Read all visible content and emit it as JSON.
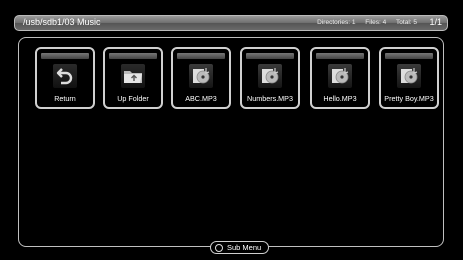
{
  "header": {
    "path": "/usb/sdb1/03 Music",
    "directories": "Directories: 1",
    "files": "Files: 4",
    "total": "Total: 5",
    "page": "1/1"
  },
  "items": [
    {
      "label": "Return",
      "icon": "return-arrow-icon"
    },
    {
      "label": "Up Folder",
      "icon": "folder-icon"
    },
    {
      "label": "ABC.MP3",
      "icon": "audio-file-icon"
    },
    {
      "label": "Numbers.MP3",
      "icon": "audio-file-icon"
    },
    {
      "label": "Hello.MP3",
      "icon": "audio-file-icon"
    },
    {
      "label": "Pretty Boy.MP3",
      "icon": "audio-file-icon"
    }
  ],
  "footer": {
    "submenu_label": "Sub Menu",
    "submenu_icon": "circle-button-icon"
  }
}
